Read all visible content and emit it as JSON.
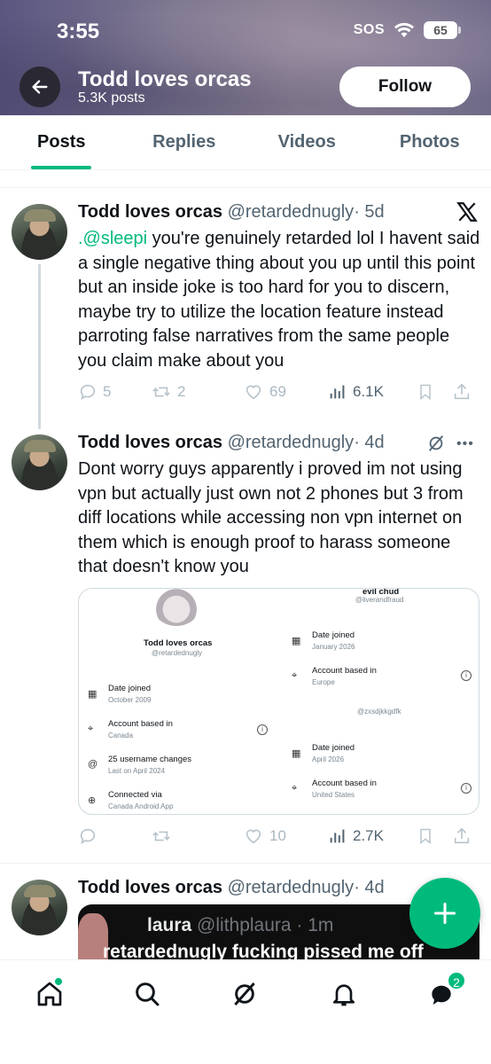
{
  "status_bar": {
    "time": "3:55",
    "sos": "SOS",
    "battery": "65"
  },
  "header": {
    "name": "Todd loves orcas",
    "post_count": "5.3K posts",
    "follow_label": "Follow"
  },
  "tabs": [
    {
      "label": "Posts",
      "active": true
    },
    {
      "label": "Replies",
      "active": false
    },
    {
      "label": "Videos",
      "active": false
    },
    {
      "label": "Photos",
      "active": false
    }
  ],
  "tweets": [
    {
      "name": "Todd loves orcas",
      "handle": "@retardednugly",
      "time": "· 5d",
      "mention": ".@sleepi",
      "text": " you're genuinely retarded lol I havent said a single negative thing about you up until this point but an inside joke is too hard for you to discern, maybe try to utilize the location feature instead parroting false narratives from the same people you claim make about you",
      "replies": "5",
      "reposts": "2",
      "likes": "69",
      "views": "6.1K"
    },
    {
      "name": "Todd loves orcas",
      "handle": "@retardednugly",
      "time": "· 4d",
      "text": "Dont worry guys apparently i proved im not using vpn but actually just own not 2 phones but 3 from diff locations while accessing non vpn internet on them which is enough proof to harass someone that doesn't know you",
      "replies": "",
      "reposts": "",
      "likes": "10",
      "views": "2.7K",
      "card": {
        "left_name": "Todd loves orcas",
        "left_handle": "@retardednugly",
        "left_rows": [
          {
            "title": "Date joined",
            "sub": "October 2009"
          },
          {
            "title": "Account based in",
            "sub": "Canada"
          },
          {
            "title": "25 username changes",
            "sub": "Last on April 2024"
          },
          {
            "title": "Connected via",
            "sub": "Canada Android App"
          }
        ],
        "right_top_name": "evil chud",
        "right_top_handle": "@liverandfraud",
        "right_top_rows": [
          {
            "title": "Date joined",
            "sub": "January 2026"
          },
          {
            "title": "Account based in",
            "sub": "Europe"
          }
        ],
        "right_mid_handle": "@zxsdjkkgdfk",
        "right_bottom_rows": [
          {
            "title": "Date joined",
            "sub": "April 2026"
          },
          {
            "title": "Account based in",
            "sub": "United States"
          }
        ]
      }
    },
    {
      "name": "Todd loves orcas",
      "handle": "@retardednugly",
      "time": "· 4d",
      "media": {
        "quoted_name": "laura",
        "quoted_meta": "@lithplaura · 1m",
        "caption": "retardednugly fucking pissed me off"
      }
    }
  ],
  "bottom_nav": {
    "messages_badge": "2"
  },
  "colors": {
    "accent": "#00ba7c",
    "text": "#0f1419",
    "muted": "#536471"
  }
}
